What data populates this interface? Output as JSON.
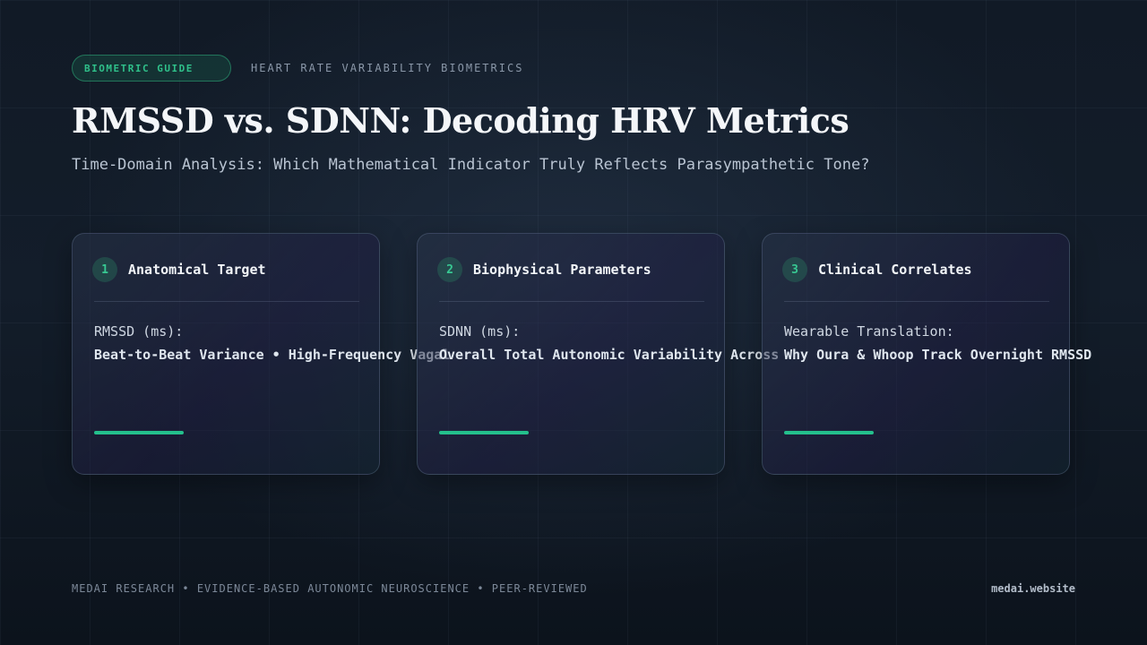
{
  "header": {
    "badge": "BIOMETRIC GUIDE",
    "topic": "HEART RATE VARIABILITY BIOMETRICS"
  },
  "title": "RMSSD vs. SDNN: Decoding HRV Metrics",
  "subtitle": "Time-Domain Analysis: Which Mathematical Indicator Truly Reflects Parasympathetic Tone?",
  "cards": [
    {
      "number": "1",
      "title": "Anatomical Target",
      "label": "RMSSD (ms):",
      "description": "Beat-to-Beat Variance • High-Frequency Vagal"
    },
    {
      "number": "2",
      "title": "Biophysical Parameters",
      "label": "SDNN (ms):",
      "description": "Overall Total Autonomic Variability Across"
    },
    {
      "number": "3",
      "title": "Clinical Correlates",
      "label": "Wearable Translation:",
      "description": "Why Oura & Whoop Track Overnight RMSSD"
    }
  ],
  "footer": {
    "left": "MEDAI RESEARCH • EVIDENCE-BASED AUTONOMIC NEUROSCIENCE • PEER-REVIEWED",
    "right": "medai.website"
  },
  "colors": {
    "accent": "#24c08c",
    "background": "#0f1722"
  }
}
